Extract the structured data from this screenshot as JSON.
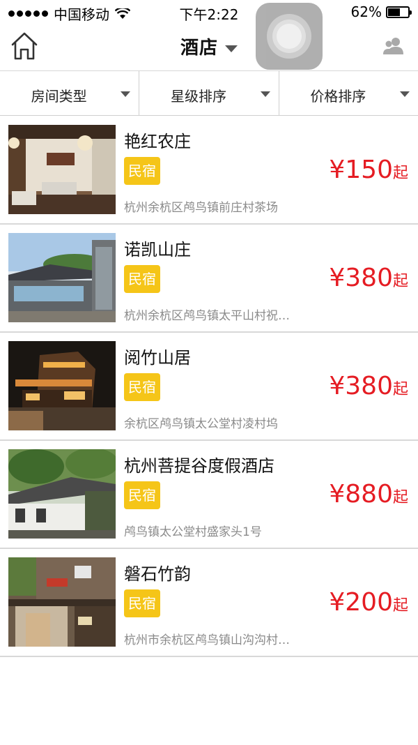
{
  "status_bar": {
    "carrier": "中国移动",
    "time": "下午2:22",
    "battery_text": "62%",
    "battery_level": 0.62
  },
  "nav": {
    "title": "酒店",
    "home_icon": "home-icon",
    "user_icon": "users-icon"
  },
  "filters": [
    {
      "label": "房间类型"
    },
    {
      "label": "星级排序"
    },
    {
      "label": "价格排序"
    }
  ],
  "colors": {
    "accent": "#e51c23",
    "badge": "#f5c518"
  },
  "hotels": [
    {
      "name": "艳红农庄",
      "badge": "民宿",
      "price": "¥150",
      "price_suffix": "起",
      "address": "杭州余杭区鸬鸟镇前庄村茶场"
    },
    {
      "name": "诺凯山庄",
      "badge": "民宿",
      "price": "¥380",
      "price_suffix": "起",
      "address": "杭州余杭区鸬鸟镇太平山村祝…"
    },
    {
      "name": "阅竹山居",
      "badge": "民宿",
      "price": "¥380",
      "price_suffix": "起",
      "address": "余杭区鸬鸟镇太公堂村凌村坞"
    },
    {
      "name": "杭州菩提谷度假酒店",
      "badge": "民宿",
      "price": "¥880",
      "price_suffix": "起",
      "address": "鸬鸟镇太公堂村盛家头1号"
    },
    {
      "name": "磐石竹韵",
      "badge": "民宿",
      "price": "¥200",
      "price_suffix": "起",
      "address": "杭州市余杭区鸬鸟镇山沟沟村…"
    }
  ]
}
